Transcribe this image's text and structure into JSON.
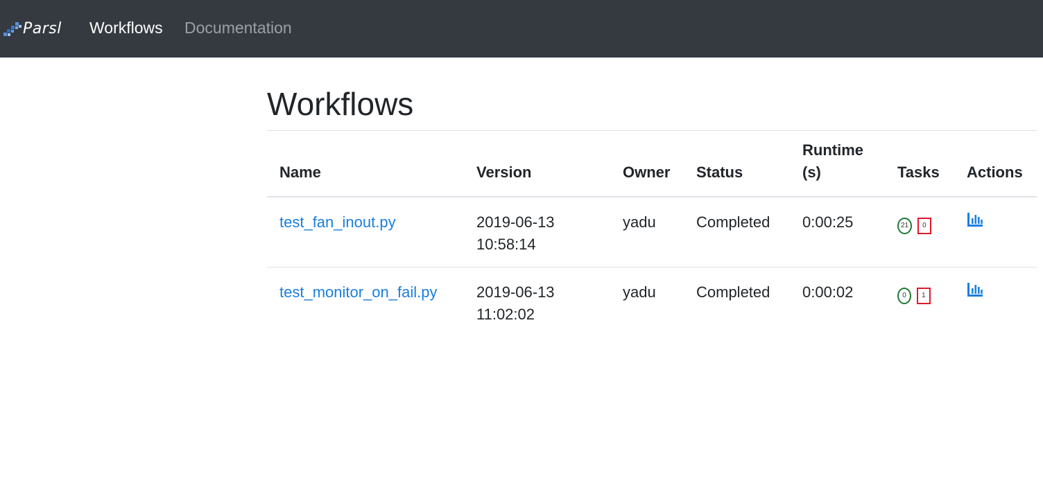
{
  "navbar": {
    "brand_text": "Parsl",
    "links": [
      "Workflows",
      "Documentation"
    ]
  },
  "page": {
    "title": "Workflows"
  },
  "table": {
    "headers": [
      "Name",
      "Version",
      "Owner",
      "Status",
      "Runtime (s)",
      "Tasks",
      "Actions"
    ],
    "rows": [
      {
        "name": "test_fan_inout.py",
        "version_date": "2019-06-13",
        "version_time": "10:58:14",
        "owner": "yadu",
        "status": "Completed",
        "runtime": "0:00:25",
        "tasks_completed": "21",
        "tasks_failed": "0",
        "action_icon": "bar-chart-icon"
      },
      {
        "name": "test_monitor_on_fail.py",
        "version_date": "2019-06-13",
        "version_time": "11:02:02",
        "owner": "yadu",
        "status": "Completed",
        "runtime": "0:00:02",
        "tasks_completed": "0",
        "tasks_failed": "1",
        "action_icon": "bar-chart-icon"
      }
    ]
  },
  "colors": {
    "navbar_bg": "#343a40",
    "link": "#1a7fe0",
    "success_badge": "#1e7a35",
    "fail_badge": "#e0192c"
  }
}
